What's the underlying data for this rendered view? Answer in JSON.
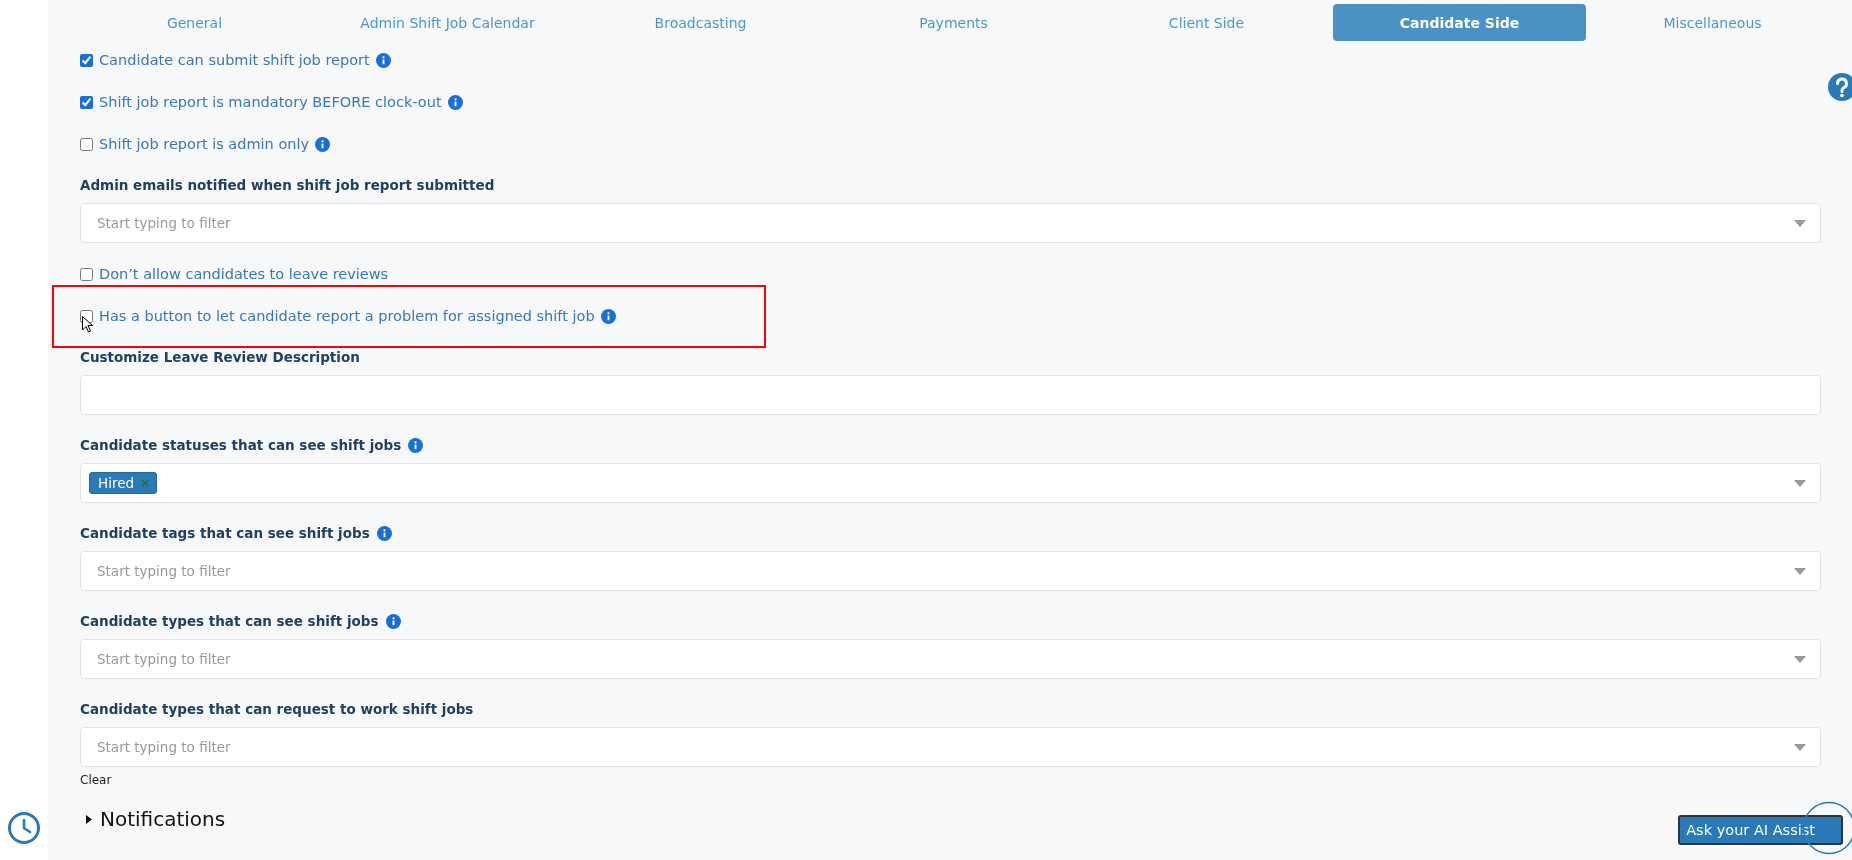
{
  "tabs": [
    {
      "label": "General",
      "selected": false
    },
    {
      "label": "Admin Shift Job Calendar",
      "selected": false
    },
    {
      "label": "Broadcasting",
      "selected": false
    },
    {
      "label": "Payments",
      "selected": false
    },
    {
      "label": "Client Side",
      "selected": false
    },
    {
      "label": "Candidate Side",
      "selected": true
    },
    {
      "label": "Miscellaneous",
      "selected": false
    }
  ],
  "settings": [
    {
      "kind": "checkbox",
      "label": "Candidate can submit shift job report",
      "checked": true,
      "info": true,
      "highlighted": false
    },
    {
      "kind": "checkbox",
      "label": "Shift job report is mandatory BEFORE clock-out",
      "checked": true,
      "info": true,
      "highlighted": false
    },
    {
      "kind": "checkbox",
      "label": "Shift job report is admin only",
      "checked": false,
      "info": true,
      "highlighted": false
    },
    {
      "kind": "select",
      "label": "Admin emails notified when shift job report submitted",
      "info": false,
      "placeholder": "Start typing to filter"
    },
    {
      "kind": "checkbox",
      "label": "Don’t allow candidates to leave reviews",
      "checked": false,
      "info": false,
      "highlighted": false
    },
    {
      "kind": "checkbox",
      "label": "Has a button to let candidate report a problem for assigned shift job",
      "checked": false,
      "info": true,
      "highlighted": true
    },
    {
      "kind": "text",
      "label": "Customize Leave Review Description",
      "info": false
    },
    {
      "kind": "select",
      "label": "Candidate statuses that can see shift jobs",
      "info": true,
      "tags": [
        {
          "label": "Hired",
          "remove": "×"
        }
      ]
    },
    {
      "kind": "select",
      "label": "Candidate tags that can see shift jobs",
      "info": true,
      "placeholder": "Start typing to filter"
    },
    {
      "kind": "select",
      "label": "Candidate types that can see shift jobs",
      "info": true,
      "placeholder": "Start typing to filter"
    },
    {
      "kind": "select",
      "label": "Candidate types that can request to work shift jobs",
      "info": false,
      "placeholder": "Start typing to filter",
      "clear_label": "Clear"
    }
  ],
  "section": {
    "label": "Notifications",
    "expanded": false
  },
  "assistant_button": {
    "label": "Ask your AI Assist"
  }
}
